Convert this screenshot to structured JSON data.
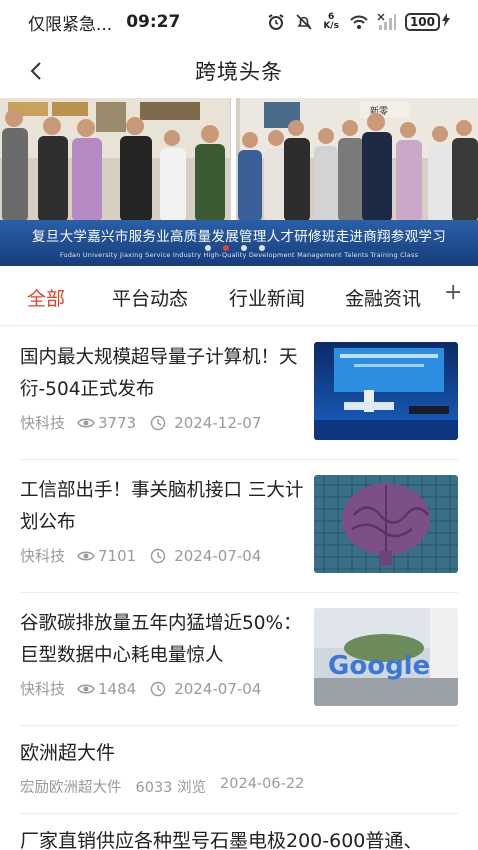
{
  "status_bar": {
    "left_text": "仅限紧急...",
    "time": "09:27",
    "net_speed_value": "6",
    "net_speed_unit": "K/s",
    "battery": "100"
  },
  "header": {
    "title": "跨境头条"
  },
  "banner": {
    "caption": "复旦大学嘉兴市服务业高质量发展管理人才研修班走进商翔参观学习",
    "caption_en": "Fudan University Jiaxing Service Industry High-Quality Development Management Talents Training Class",
    "sign_text": "新零"
  },
  "tabs": [
    {
      "label": "全部"
    },
    {
      "label": "平台动态"
    },
    {
      "label": "行业新闻"
    },
    {
      "label": "金融资讯"
    }
  ],
  "tab_add": "+",
  "news": [
    {
      "title": "国内最大规模超导量子计算机！天衍-504正式发布",
      "source": "快科技",
      "views": "3773",
      "date": "2024-12-07",
      "thumb_icon": "quantum-computer-stage-image"
    },
    {
      "title": "工信部出手！事关脑机接口 三大计划公布",
      "source": "快科技",
      "views": "7101",
      "date": "2024-07-04",
      "thumb_icon": "brain-image"
    },
    {
      "title": "谷歌碳排放量五年内猛增近50%：巨型数据中心耗电量惊人",
      "source": "快科技",
      "views": "1484",
      "date": "2024-07-04",
      "thumb_icon": "google-sign-image",
      "thumb_text": "Google"
    }
  ],
  "simple_news": [
    {
      "title": "欧洲超大件",
      "source": "宏励欧洲超大件",
      "views": "6033 浏览",
      "date": "2024-06-22"
    },
    {
      "title": "厂家直销供应各种型号石墨电极200-600普通、"
    }
  ],
  "colors": {
    "accent": "#d9442b",
    "banner_caption_bg": "#1f4f95",
    "meta_text": "#9a9a9a"
  }
}
